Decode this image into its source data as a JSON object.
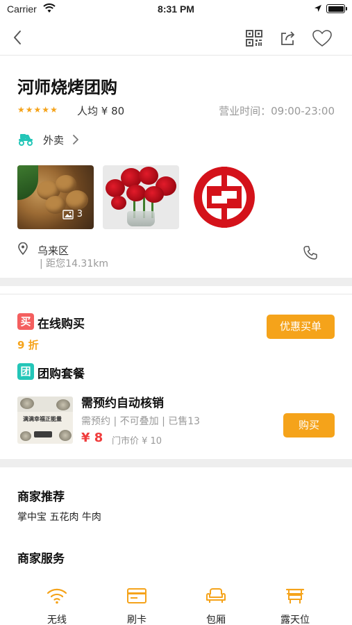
{
  "status_bar": {
    "carrier": "Carrier",
    "time": "8:31 PM"
  },
  "nav": {
    "icons": [
      "back-icon",
      "qr-code-icon",
      "share-icon",
      "heart-icon"
    ]
  },
  "shop": {
    "name": "河师烧烤团购",
    "rating_stars": 5,
    "avg_price": "人均 ¥ 80",
    "hours": "营业时间：09:00-23:00",
    "delivery_label": "外卖",
    "photo_count": "3",
    "area": "乌来区",
    "distance": "| 距您14.31km"
  },
  "online_buy": {
    "badge": "买",
    "title": "在线购买",
    "discount": "9 折",
    "button": "优惠买单"
  },
  "group_buy": {
    "badge": "团",
    "title": "团购套餐",
    "deal": {
      "image_text": "满满幸福正能量",
      "title": "需预约自动核销",
      "subtitle": "需预约 | 不可叠加 | 已售13",
      "price": "¥ 8",
      "original_price": "门市价 ¥ 10",
      "button": "购买"
    }
  },
  "recommend": {
    "title": "商家推荐",
    "items": "掌中宝 五花肉 牛肉"
  },
  "services": {
    "title": "商家服务",
    "items": [
      {
        "label": "无线",
        "icon": "wifi-icon"
      },
      {
        "label": "刷卡",
        "icon": "card-icon"
      },
      {
        "label": "包厢",
        "icon": "sofa-icon"
      },
      {
        "label": "露天位",
        "icon": "outdoor-seat-icon"
      }
    ]
  },
  "colors": {
    "accent": "#f5a31a",
    "price_red": "#f03c3c",
    "buy_badge": "#f45f5f",
    "group_badge": "#24c6b8",
    "bank_logo_red": "#d4121a"
  }
}
